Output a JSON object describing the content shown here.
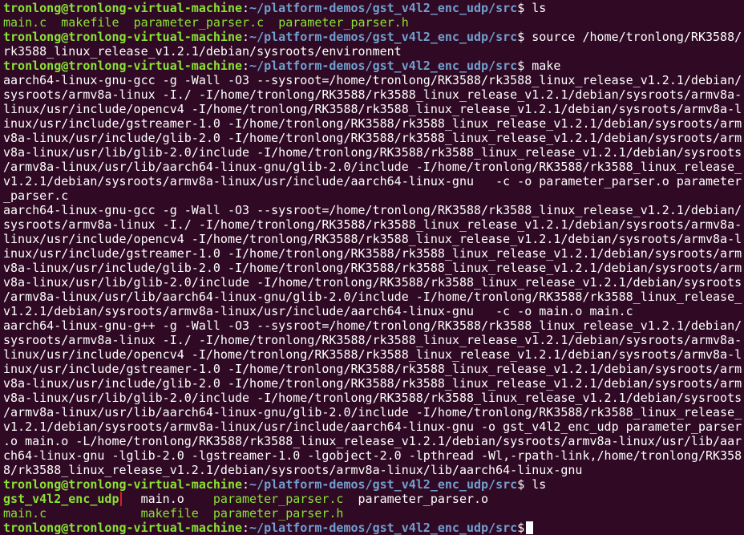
{
  "colors": {
    "background": "#300a24",
    "prompt_user": "#8ae234",
    "prompt_path": "#729fcf",
    "highlight_box": "#e01b24"
  },
  "prompt": {
    "user_host": "tronlong@tronlong-virtual-machine",
    "sep": ":",
    "path": "~/platform-demos/gst_v4l2_enc_udp/src",
    "dollar": "$"
  },
  "commands": {
    "ls1": " ls",
    "source_a": " source /home/tronlong/RK3588/",
    "source_b": "rk3588_linux_release_v1.2.1/debian/sysroots/environment",
    "make": " make",
    "ls2": " ls"
  },
  "ls1_files": [
    "main.c",
    "makefile",
    "parameter_parser.c",
    "parameter_parser.h"
  ],
  "make_output": [
    "aarch64-linux-gnu-gcc -g -Wall -O3 --sysroot=/home/tronlong/RK3588/rk3588_linux_release_v1.2.1/debian/",
    "sysroots/armv8a-linux -I./ -I/home/tronlong/RK3588/rk3588_linux_release_v1.2.1/debian/sysroots/armv8a-",
    "linux/usr/include/opencv4 -I/home/tronlong/RK3588/rk3588_linux_release_v1.2.1/debian/sysroots/armv8a-l",
    "inux/usr/include/gstreamer-1.0 -I/home/tronlong/RK3588/rk3588_linux_release_v1.2.1/debian/sysroots/arm",
    "v8a-linux/usr/include/glib-2.0 -I/home/tronlong/RK3588/rk3588_linux_release_v1.2.1/debian/sysroots/arm",
    "v8a-linux/usr/lib/glib-2.0/include -I/home/tronlong/RK3588/rk3588_linux_release_v1.2.1/debian/sysroots",
    "/armv8a-linux/usr/lib/aarch64-linux-gnu/glib-2.0/include -I/home/tronlong/RK3588/rk3588_linux_release_",
    "v1.2.1/debian/sysroots/armv8a-linux/usr/include/aarch64-linux-gnu   -c -o parameter_parser.o parameter",
    "_parser.c",
    "aarch64-linux-gnu-gcc -g -Wall -O3 --sysroot=/home/tronlong/RK3588/rk3588_linux_release_v1.2.1/debian/",
    "sysroots/armv8a-linux -I./ -I/home/tronlong/RK3588/rk3588_linux_release_v1.2.1/debian/sysroots/armv8a-",
    "linux/usr/include/opencv4 -I/home/tronlong/RK3588/rk3588_linux_release_v1.2.1/debian/sysroots/armv8a-l",
    "inux/usr/include/gstreamer-1.0 -I/home/tronlong/RK3588/rk3588_linux_release_v1.2.1/debian/sysroots/arm",
    "v8a-linux/usr/include/glib-2.0 -I/home/tronlong/RK3588/rk3588_linux_release_v1.2.1/debian/sysroots/arm",
    "v8a-linux/usr/lib/glib-2.0/include -I/home/tronlong/RK3588/rk3588_linux_release_v1.2.1/debian/sysroots",
    "/armv8a-linux/usr/lib/aarch64-linux-gnu/glib-2.0/include -I/home/tronlong/RK3588/rk3588_linux_release_",
    "v1.2.1/debian/sysroots/armv8a-linux/usr/include/aarch64-linux-gnu   -c -o main.o main.c",
    "aarch64-linux-gnu-g++ -g -Wall -O3 --sysroot=/home/tronlong/RK3588/rk3588_linux_release_v1.2.1/debian/",
    "sysroots/armv8a-linux -I./ -I/home/tronlong/RK3588/rk3588_linux_release_v1.2.1/debian/sysroots/armv8a-",
    "linux/usr/include/opencv4 -I/home/tronlong/RK3588/rk3588_linux_release_v1.2.1/debian/sysroots/armv8a-l",
    "inux/usr/include/gstreamer-1.0 -I/home/tronlong/RK3588/rk3588_linux_release_v1.2.1/debian/sysroots/arm",
    "v8a-linux/usr/include/glib-2.0 -I/home/tronlong/RK3588/rk3588_linux_release_v1.2.1/debian/sysroots/arm",
    "v8a-linux/usr/lib/glib-2.0/include -I/home/tronlong/RK3588/rk3588_linux_release_v1.2.1/debian/sysroots",
    "/armv8a-linux/usr/lib/aarch64-linux-gnu/glib-2.0/include -I/home/tronlong/RK3588/rk3588_linux_release_",
    "v1.2.1/debian/sysroots/armv8a-linux/usr/include/aarch64-linux-gnu -o gst_v4l2_enc_udp parameter_parser",
    ".o main.o -L/home/tronlong/RK3588/rk3588_linux_release_v1.2.1/debian/sysroots/armv8a-linux/usr/lib/aar",
    "ch64-linux-gnu -lglib-2.0 -lgstreamer-1.0 -lgobject-2.0 -lpthread -Wl,-rpath-link,/home/tronlong/RK358",
    "8/rk3588_linux_release_v1.2.1/debian/sysroots/armv8a-linux/lib/aarch64-linux-gnu"
  ],
  "ls2_row1": [
    "gst_v4l2_enc_udp",
    "main.o",
    "parameter_parser.c",
    "parameter_parser.o"
  ],
  "ls2_row2": [
    "main.c",
    "makefile",
    "parameter_parser.h"
  ]
}
